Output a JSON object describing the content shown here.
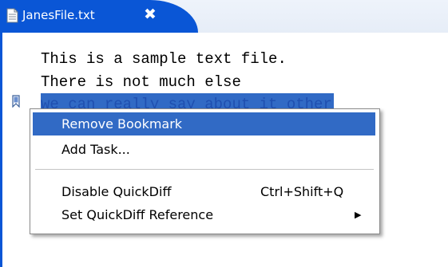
{
  "tab": {
    "title": "JanesFile.txt",
    "close_symbol": "✖"
  },
  "editor": {
    "lines": [
      "This is a sample text file.",
      "There is not much else",
      "we can really say about it other"
    ]
  },
  "context_menu": {
    "items": [
      {
        "label": "Remove Bookmark",
        "highlighted": true
      },
      {
        "label": "Add Task..."
      },
      {
        "label": "Disable QuickDiff",
        "shortcut": "Ctrl+Shift+Q"
      },
      {
        "label": "Set QuickDiff Reference",
        "submenu_icon": "▶"
      }
    ]
  },
  "icons": {
    "tab": "text-file-icon",
    "close": "close-icon",
    "bookmark": "bookmark-icon",
    "submenu": "submenu-arrow-icon"
  },
  "colors": {
    "tab_active": "#0a56d6",
    "selection": "#316ac5",
    "menu_highlight": "#316ac5"
  }
}
